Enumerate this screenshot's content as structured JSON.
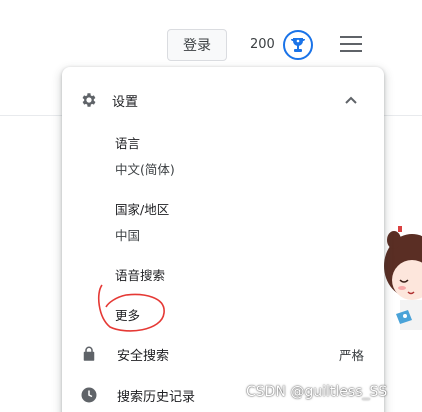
{
  "header": {
    "login_label": "登录",
    "points": "200",
    "badge_icon": "trophy-icon",
    "menu_icon": "hamburger-menu-icon"
  },
  "menu": {
    "settings_label": "设置",
    "language_title": "语言",
    "language_value": "中文(简体)",
    "region_title": "国家/地区",
    "region_value": "中国",
    "voice_search_label": "语音搜索",
    "more_label": "更多",
    "safe_search_label": "安全搜索",
    "safe_search_value": "严格",
    "history_label": "搜索历史记录"
  },
  "watermark": "CSDN @guiltless_SS",
  "colors": {
    "accent": "#1a73e8",
    "annotation": "#e53935"
  }
}
